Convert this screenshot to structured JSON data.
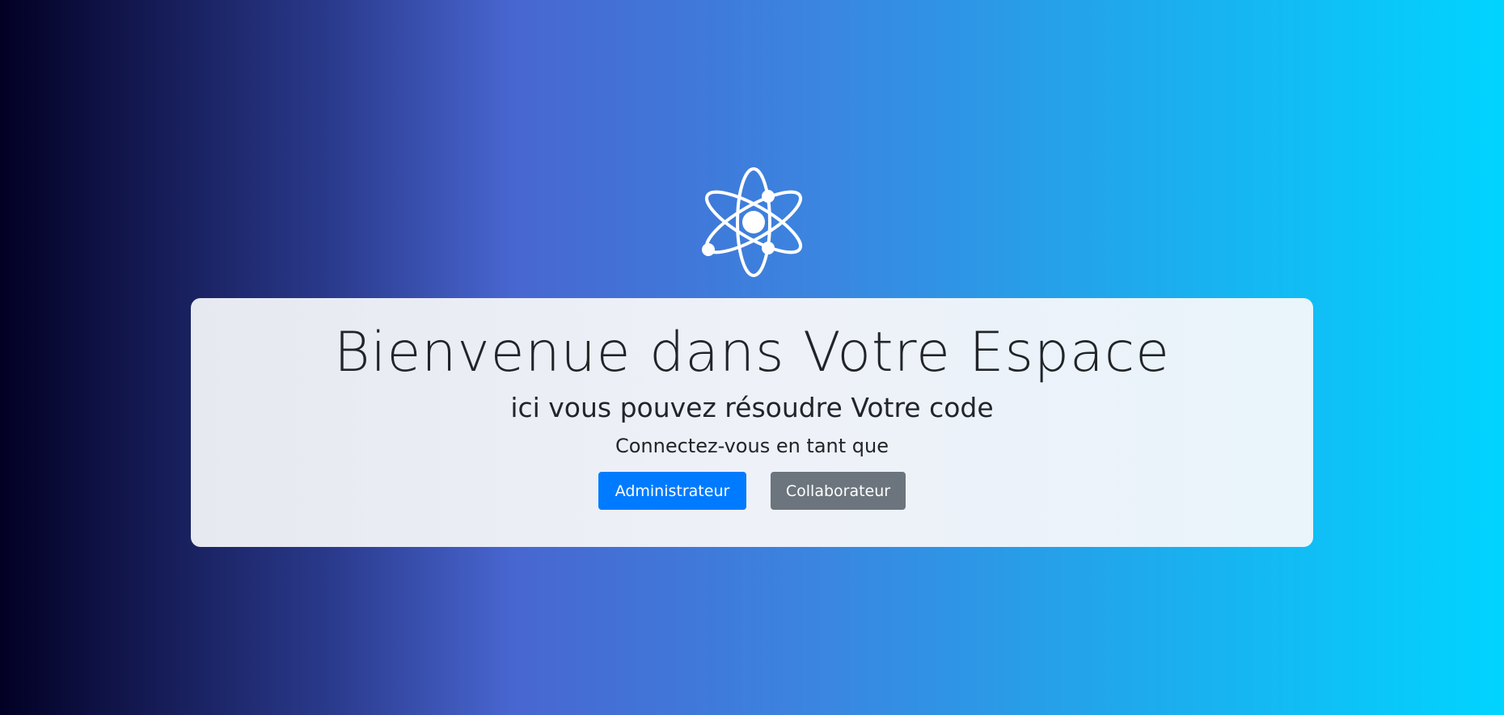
{
  "logo": {
    "icon": "atom-icon",
    "color": "#ffffff"
  },
  "card": {
    "title": "Bienvenue dans Votre Espace",
    "subtitle": "ici vous pouvez résoudre Votre code",
    "prompt": "Connectez-vous en tant que"
  },
  "buttons": {
    "admin_label": "Administrateur",
    "admin_color": "#007bff",
    "collab_label": "Collaborateur",
    "collab_color": "#6c757d"
  }
}
